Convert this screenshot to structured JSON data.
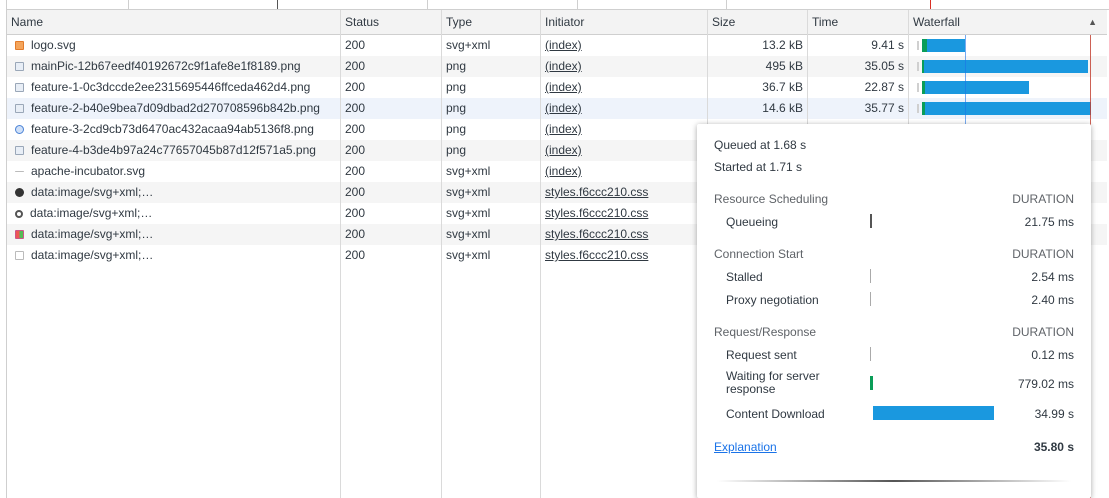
{
  "columns": [
    "Name",
    "Status",
    "Type",
    "Initiator",
    "Size",
    "Time",
    "Waterfall"
  ],
  "sort_indicator": "▲",
  "rows": [
    {
      "name": "logo.svg",
      "icon": "svg-file-icon",
      "status": "200",
      "type": "svg+xml",
      "initiator": "(index)",
      "size": "13.2 kB",
      "time": "9.41 s"
    },
    {
      "name": "mainPic-12b67eedf40192672c9f1afe8e1f8189.png",
      "icon": "image-file-icon",
      "status": "200",
      "type": "png",
      "initiator": "(index)",
      "size": "495 kB",
      "time": "35.05 s"
    },
    {
      "name": "feature-1-0c3dccde2ee2315695446ffceda462d4.png",
      "icon": "image-file-icon",
      "status": "200",
      "type": "png",
      "initiator": "(index)",
      "size": "36.7 kB",
      "time": "22.87 s"
    },
    {
      "name": "feature-2-b40e9bea7d09dbad2d270708596b842b.png",
      "icon": "image-file-icon",
      "status": "200",
      "type": "png",
      "initiator": "(index)",
      "size": "14.6 kB",
      "time": "35.77 s"
    },
    {
      "name": "feature-3-2cd9cb73d6470ac432acaa94ab5136f8.png",
      "icon": "image-file-icon",
      "status": "200",
      "type": "png",
      "initiator": "(index)",
      "size": "",
      "time": ""
    },
    {
      "name": "feature-4-b3de4b97a24c77657045b87d12f571a5.png",
      "icon": "image-file-icon",
      "status": "200",
      "type": "png",
      "initiator": "(index)",
      "size": "",
      "time": ""
    },
    {
      "name": "apache-incubator.svg",
      "icon": "svg-file-icon",
      "status": "200",
      "type": "svg+xml",
      "initiator": "(index)",
      "size": "",
      "time": ""
    },
    {
      "name": "data:image/svg+xml;…",
      "icon": "github-icon",
      "status": "200",
      "type": "svg+xml",
      "initiator": "styles.f6ccc210.css",
      "size": "",
      "time": ""
    },
    {
      "name": "data:image/svg+xml;…",
      "icon": "search-icon",
      "status": "200",
      "type": "svg+xml",
      "initiator": "styles.f6ccc210.css",
      "size": "",
      "time": ""
    },
    {
      "name": "data:image/svg+xml;…",
      "icon": "grid-icon",
      "status": "200",
      "type": "svg+xml",
      "initiator": "styles.f6ccc210.css",
      "size": "",
      "time": ""
    },
    {
      "name": "data:image/svg+xml;…",
      "icon": "page-icon",
      "status": "200",
      "type": "svg+xml",
      "initiator": "styles.f6ccc210.css",
      "size": "",
      "time": ""
    }
  ],
  "timing_popup": {
    "queued": "Queued at 1.68 s",
    "started": "Started at 1.71 s",
    "sections": [
      {
        "title": "Resource Scheduling",
        "duration_label": "DURATION",
        "items": [
          {
            "label": "Queueing",
            "value": "21.75 ms",
            "bar_color": "#555555"
          }
        ]
      },
      {
        "title": "Connection Start",
        "duration_label": "DURATION",
        "items": [
          {
            "label": "Stalled",
            "value": "2.54 ms",
            "bar_color": "#aaaaaa"
          },
          {
            "label": "Proxy negotiation",
            "value": "2.40 ms",
            "bar_color": "#aaaaaa"
          }
        ]
      },
      {
        "title": "Request/Response",
        "duration_label": "DURATION",
        "items": [
          {
            "label": "Request sent",
            "value": "0.12 ms",
            "bar_color": "#aaaaaa"
          },
          {
            "label": "Waiting for server response",
            "value": "779.02 ms",
            "bar_color": "#0a9d58"
          },
          {
            "label": "Content Download",
            "value": "34.99 s",
            "bar_color": "#1a98df"
          }
        ]
      }
    ],
    "explanation_link": "Explanation",
    "total": "35.80 s"
  },
  "colors": {
    "waiting": "#0a9d58",
    "download": "#1a98df",
    "dom_content_loaded": "#1a73e8",
    "load": "#c0392b"
  }
}
